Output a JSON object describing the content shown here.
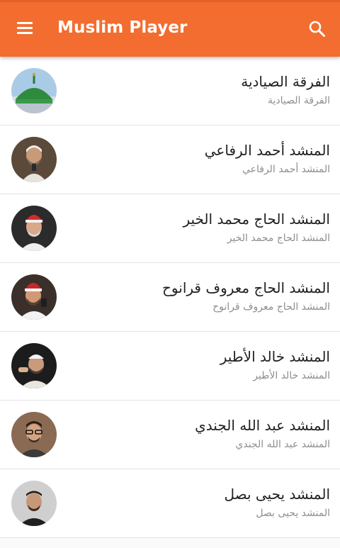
{
  "appbar": {
    "title": "Muslim Player",
    "menu_icon": "menu-icon",
    "search_icon": "search-icon",
    "color": "#f26d2f"
  },
  "items": [
    {
      "title": "الفرقة الصيادية",
      "subtitle": "الفرقة الصيادية",
      "avatar": "green-dome-photo"
    },
    {
      "title": "المنشد أحمد الرفاعي",
      "subtitle": "المنشد أحمد الرفاعي",
      "avatar": "singer-photo"
    },
    {
      "title": "المنشد الحاج محمد الخير",
      "subtitle": "المنشد الحاج محمد الخير",
      "avatar": "singer-photo"
    },
    {
      "title": "المنشد الحاج معروف قرانوح",
      "subtitle": "المنشد الحاج معروف قرانوح",
      "avatar": "singer-photo"
    },
    {
      "title": "المنشد خالد الأطير",
      "subtitle": "المنشد خالد الأطير",
      "avatar": "singer-photo"
    },
    {
      "title": "المنشد عبد الله الجندي",
      "subtitle": "المنشد عبد الله الجندي",
      "avatar": "singer-photo"
    },
    {
      "title": "المنشد يحيى بصل",
      "subtitle": "المنشد يحيى بصل",
      "avatar": "singer-photo"
    }
  ]
}
